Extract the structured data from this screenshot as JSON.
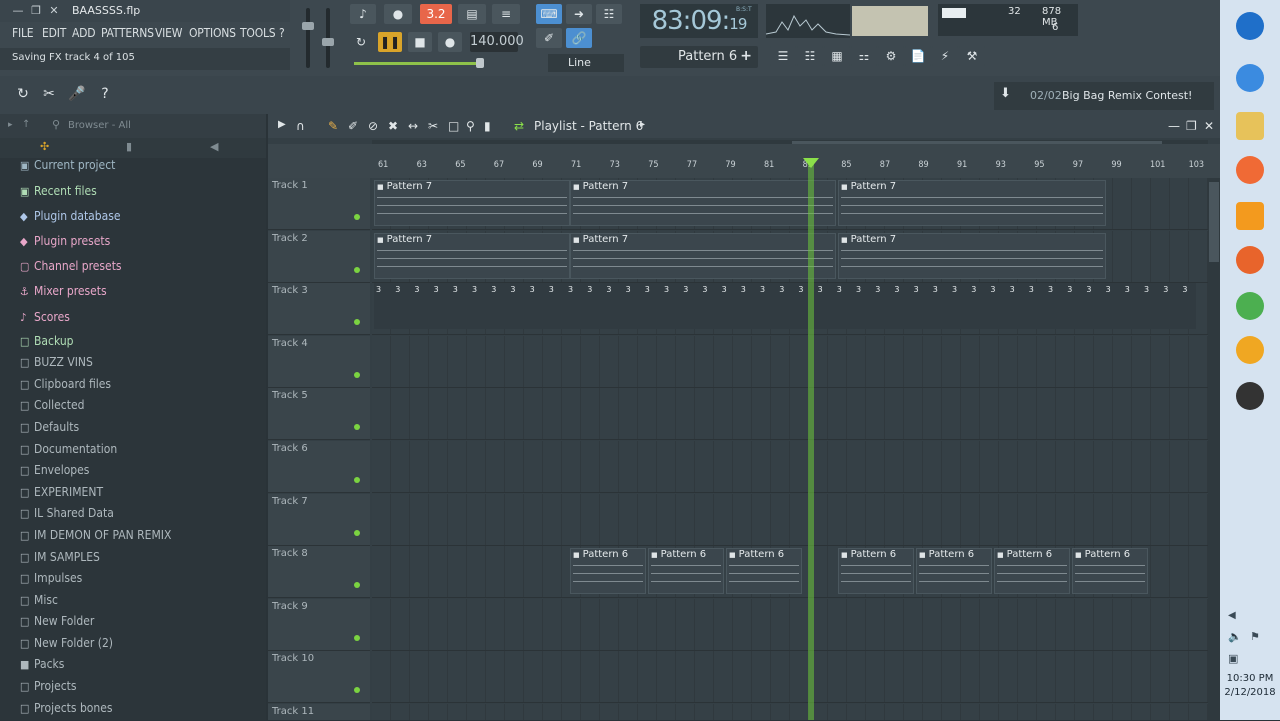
{
  "window": {
    "title": "BAASSSS.flp",
    "menus": [
      "FILE",
      "EDIT",
      "ADD",
      "PATTERNS",
      "VIEW",
      "OPTIONS",
      "TOOLS",
      "?"
    ],
    "hint": "Saving FX track 4 of 105"
  },
  "transport": {
    "tempo": "140.000",
    "time_main": "83:09",
    "time_sub": "19",
    "time_label": "B:S:T",
    "snap": "Line",
    "pattern": "Pattern 6",
    "counter": "3.2",
    "cpu_value": "32",
    "memory": "878 MB",
    "polyphony": "6"
  },
  "news": {
    "count": "02/02",
    "text": "Big Bag Remix Contest!"
  },
  "browser": {
    "header": "Browser - All",
    "items": [
      {
        "label": "Current project",
        "icon": "project-icon",
        "color": "#9fb7c4"
      },
      {
        "label": "Recent files",
        "icon": "recent-icon",
        "color": "#b0ddb5"
      },
      {
        "label": "Plugin database",
        "icon": "plug-icon",
        "color": "#aec7e8"
      },
      {
        "label": "Plugin presets",
        "icon": "plug-icon",
        "color": "#e8a7c9"
      },
      {
        "label": "Channel presets",
        "icon": "channel-icon",
        "color": "#e8a7c9"
      },
      {
        "label": "Mixer presets",
        "icon": "mixer-icon",
        "color": "#e8a7c9"
      },
      {
        "label": "Scores",
        "icon": "note-icon",
        "color": "#e8a7c9"
      },
      {
        "label": "Backup",
        "icon": "folder-icon",
        "color": "#b0ddb5"
      },
      {
        "label": "BUZZ VINS",
        "icon": "folder-icon",
        "color": "#aeb8bd"
      },
      {
        "label": "Clipboard files",
        "icon": "folder-icon",
        "color": "#aeb8bd"
      },
      {
        "label": "Collected",
        "icon": "folder-icon",
        "color": "#aeb8bd"
      },
      {
        "label": "Defaults",
        "icon": "folder-icon",
        "color": "#aeb8bd"
      },
      {
        "label": "Documentation",
        "icon": "folder-icon",
        "color": "#aeb8bd"
      },
      {
        "label": "Envelopes",
        "icon": "folder-icon",
        "color": "#aeb8bd"
      },
      {
        "label": "EXPERIMENT",
        "icon": "folder-icon",
        "color": "#aeb8bd"
      },
      {
        "label": "IL Shared Data",
        "icon": "folder-icon",
        "color": "#aeb8bd"
      },
      {
        "label": "IM DEMON OF PAN REMIX",
        "icon": "folder-icon",
        "color": "#aeb8bd"
      },
      {
        "label": "IM SAMPLES",
        "icon": "folder-icon",
        "color": "#aeb8bd"
      },
      {
        "label": "Impulses",
        "icon": "folder-icon",
        "color": "#aeb8bd"
      },
      {
        "label": "Misc",
        "icon": "folder-icon",
        "color": "#aeb8bd"
      },
      {
        "label": "New Folder",
        "icon": "folder-icon",
        "color": "#aeb8bd"
      },
      {
        "label": "New Folder (2)",
        "icon": "folder-icon",
        "color": "#aeb8bd"
      },
      {
        "label": "Packs",
        "icon": "packs-icon",
        "color": "#aeb8bd"
      },
      {
        "label": "Projects",
        "icon": "folder-icon",
        "color": "#aeb8bd"
      },
      {
        "label": "Projects bones",
        "icon": "folder-icon",
        "color": "#aeb8bd"
      }
    ]
  },
  "playlist": {
    "title": "Playlist - Pattern 6",
    "ruler": [
      "61",
      "63",
      "65",
      "67",
      "69",
      "71",
      "73",
      "75",
      "77",
      "79",
      "81",
      "83",
      "85",
      "87",
      "89",
      "91",
      "93",
      "95",
      "97",
      "99",
      "101",
      "103"
    ],
    "tracks": [
      "Track 1",
      "Track 2",
      "Track 3",
      "Track 4",
      "Track 5",
      "Track 6",
      "Track 7",
      "Track 8",
      "Track 9",
      "Track 10",
      "Track 11"
    ],
    "clip_label_7": "Pattern 7",
    "clip_label_6": "Pattern 6",
    "mini_clip_label": "3"
  },
  "taskbar": {
    "time": "10:30 PM",
    "date": "2/12/2018"
  }
}
